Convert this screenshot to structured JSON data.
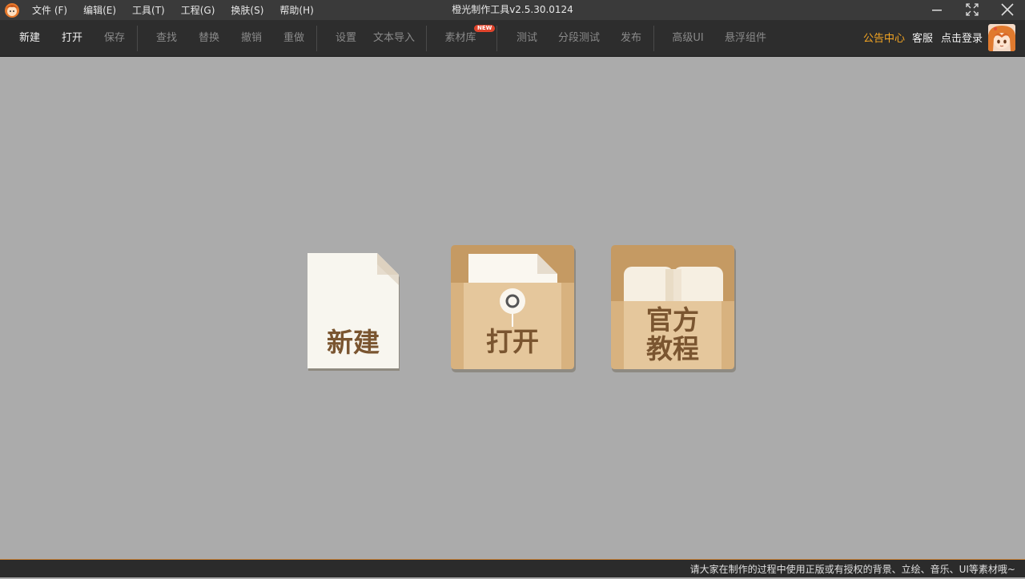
{
  "window": {
    "title": "橙光制作工具v2.5.30.0124",
    "menu": [
      "文件 (F)",
      "编辑(E)",
      "工具(T)",
      "工程(G)",
      "换肤(S)",
      "帮助(H)"
    ]
  },
  "toolbar": {
    "new": "新建",
    "open": "打开",
    "save": "保存",
    "find": "查找",
    "replace": "替换",
    "undo": "撤销",
    "redo": "重做",
    "settings": "设置",
    "text_import": "文本导入",
    "assets": "素材库",
    "assets_badge": "NEW",
    "test": "测试",
    "segment_test": "分段测试",
    "publish": "发布",
    "advanced_ui": "高级UI",
    "floating_widget": "悬浮组件",
    "announcements": "公告中心",
    "support": "客服",
    "login": "点击登录"
  },
  "tiles": {
    "new_label": "新建",
    "open_label": "打开",
    "tutorial_line1": "官方",
    "tutorial_line2": "教程"
  },
  "status": {
    "notice": "请大家在制作的过程中使用正版或有授权的背景、立绘、音乐、UI等素材哦~"
  },
  "colors": {
    "accent_orange": "#f5a623",
    "tile_tan": "#d9b486",
    "tile_text": "#7a5530"
  }
}
